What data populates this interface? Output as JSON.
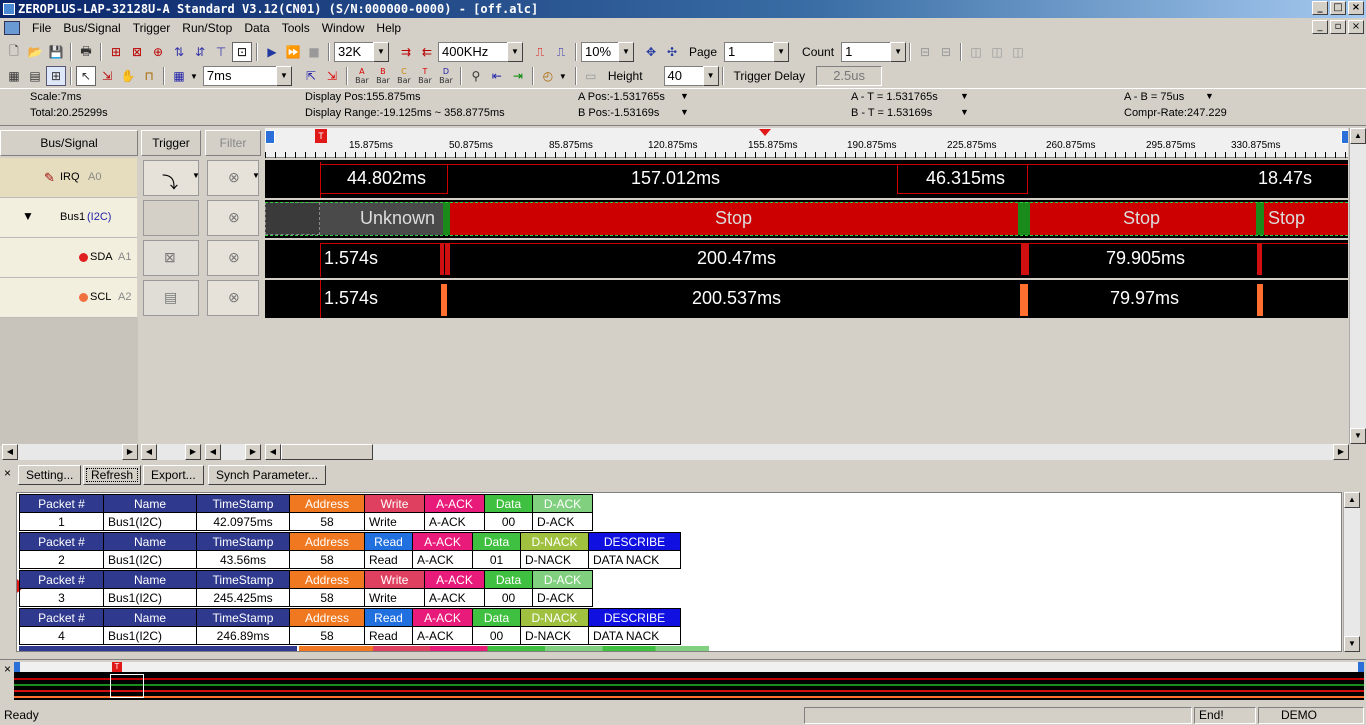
{
  "window": {
    "title": "ZEROPLUS-LAP-32128U-A Standard V3.12(CN01) (S/N:000000-0000) - [off.alc]"
  },
  "menu": [
    "File",
    "Bus/Signal",
    "Trigger",
    "Run/Stop",
    "Data",
    "Tools",
    "Window",
    "Help"
  ],
  "toolbar1": {
    "memory": "32K",
    "frequency": "400KHz",
    "zoom": "10%",
    "page_label": "Page",
    "page_value": "1",
    "count_label": "Count",
    "count_value": "1"
  },
  "toolbar2": {
    "time_value": "7ms",
    "height_label": "Height",
    "height_value": "40",
    "trigger_delay_label": "Trigger Delay",
    "trigger_delay_value": "2.5us",
    "bar_labels": [
      "Bar",
      "Bar",
      "Bar",
      "Bar",
      "Bar"
    ]
  },
  "info": {
    "scale": "Scale:7ms",
    "total": "Total:20.25299s",
    "display_pos": "Display Pos:155.875ms",
    "display_range": "Display Range:-19.125ms ~ 358.8775ms",
    "a_pos": "A Pos:-1.531765s",
    "b_pos": "B Pos:-1.53169s",
    "a_t": "A - T = 1.531765s",
    "b_t": "B - T = 1.53169s",
    "a_b": "A - B = 75us",
    "compr": "Compr-Rate:247.229"
  },
  "panels": {
    "bus_signal": "Bus/Signal",
    "trigger": "Trigger",
    "filter": "Filter"
  },
  "signals": [
    {
      "name": "IRQ",
      "ch": "A0"
    },
    {
      "name": "Bus1",
      "ch": "(I2C)"
    },
    {
      "name": "SDA",
      "ch": "A1"
    },
    {
      "name": "SCL",
      "ch": "A2"
    }
  ],
  "timeline": {
    "ticks": [
      "15.875ms",
      "50.875ms",
      "85.875ms",
      "120.875ms",
      "155.875ms",
      "190.875ms",
      "225.875ms",
      "260.875ms",
      "295.875ms",
      "330.875ms"
    ],
    "trigger_marker": "T"
  },
  "tracks": {
    "irq": [
      "44.802ms",
      "157.012ms",
      "46.315ms",
      "18.47s"
    ],
    "bus": [
      "Unknown",
      "Stop",
      "Stop",
      "Stop"
    ],
    "sda": [
      "1.574s",
      "200.47ms",
      "79.905ms"
    ],
    "scl": [
      "1.574s",
      "200.537ms",
      "79.97ms"
    ]
  },
  "colors": {
    "wave_bg": "#000000",
    "stop": "#cc0000",
    "ack": "#1a8a1a",
    "scl_pulse": "#ff7030",
    "unknown": "#3a3a3a"
  },
  "packet_buttons": {
    "setting": "Setting...",
    "refresh": "Refresh",
    "export": "Export...",
    "synch": "Synch Parameter..."
  },
  "packet_headers": {
    "packet": "Packet #",
    "name": "Name",
    "timestamp": "TimeStamp",
    "address": "Address",
    "write": "Write",
    "read": "Read",
    "a_ack": "A-ACK",
    "data": "Data",
    "d_ack": "D-ACK",
    "d_nack": "D-NACK",
    "describe": "DESCRIBE"
  },
  "packets": [
    {
      "no": "1",
      "name": "Bus1(I2C)",
      "ts": "42.0975ms",
      "addr": "58",
      "rw": "Write",
      "aack": "A-ACK",
      "data": "00",
      "dack": "D-ACK",
      "desc": ""
    },
    {
      "no": "2",
      "name": "Bus1(I2C)",
      "ts": "43.56ms",
      "addr": "58",
      "rw": "Read",
      "aack": "A-ACK",
      "data": "01",
      "dack": "D-NACK",
      "desc": "DATA NACK"
    },
    {
      "no": "3",
      "name": "Bus1(I2C)",
      "ts": "245.425ms",
      "addr": "58",
      "rw": "Write",
      "aack": "A-ACK",
      "data": "00",
      "dack": "D-ACK",
      "desc": ""
    },
    {
      "no": "4",
      "name": "Bus1(I2C)",
      "ts": "246.89ms",
      "addr": "58",
      "rw": "Read",
      "aack": "A-ACK",
      "data": "00",
      "dack": "D-NACK",
      "desc": "DATA NACK"
    }
  ],
  "status": {
    "ready": "Ready",
    "end": "End!",
    "demo": "DEMO"
  }
}
